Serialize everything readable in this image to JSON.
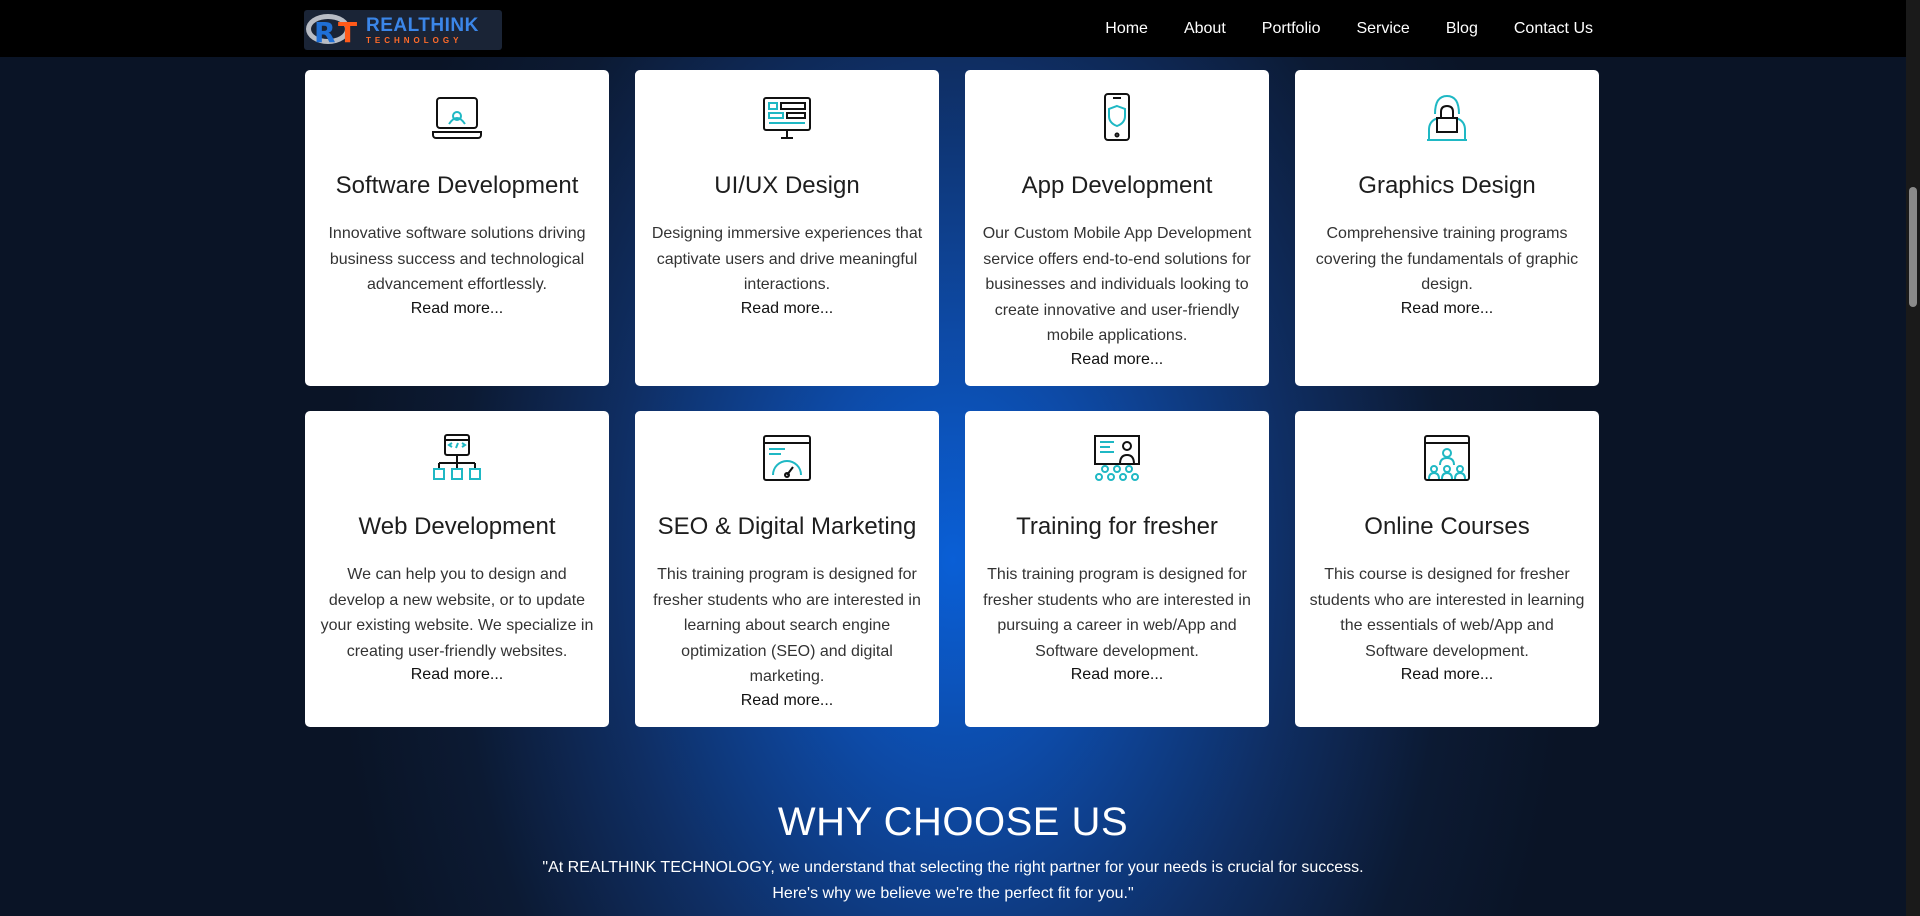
{
  "brand": {
    "name": "REALTHINK",
    "sub": "TECHNOLOGY",
    "mark_r": "R",
    "mark_t": "T"
  },
  "nav": [
    "Home",
    "About",
    "Portfolio",
    "Service",
    "Blog",
    "Contact Us"
  ],
  "cards": [
    {
      "icon": "laptop-icon",
      "title": "Software Development",
      "desc": "Innovative software solutions driving business success and technological advancement effortlessly.",
      "more": "Read more..."
    },
    {
      "icon": "monitor-layout-icon",
      "title": "UI/UX Design",
      "desc": "Designing immersive experiences that captivate users and drive meaningful interactions.",
      "more": "Read more..."
    },
    {
      "icon": "smartphone-icon",
      "title": "App Development",
      "desc": "Our Custom Mobile App Development service offers end-to-end solutions for businesses and individuals looking to create innovative and user-friendly mobile applications.",
      "more": "Read more..."
    },
    {
      "icon": "hacker-icon",
      "title": "Graphics Design",
      "desc": "Comprehensive training programs covering the fundamentals of graphic design.",
      "more": "Read more..."
    },
    {
      "icon": "code-network-icon",
      "title": "Web Development",
      "desc": "We can help you to design and develop a new website, or to update your existing website. We specialize in creating user-friendly websites.",
      "more": "Read more..."
    },
    {
      "icon": "speed-gauge-icon",
      "title": "SEO & Digital Marketing",
      "desc": "This training program is designed for fresher students who are interested in learning about search engine optimization (SEO) and digital marketing.",
      "more": "Read more..."
    },
    {
      "icon": "classroom-icon",
      "title": "Training for fresher",
      "desc": "This training program is designed for fresher students who are interested in pursuing a career in web/App and Software development.",
      "more": "Read more..."
    },
    {
      "icon": "online-course-icon",
      "title": "Online Courses",
      "desc": "This course is designed for fresher students who are interested in learning the essentials of web/App and Software development.",
      "more": "Read more..."
    }
  ],
  "why": {
    "title": "WHY CHOOSE US",
    "line1": "\"At REALTHINK TECHNOLOGY, we understand that selecting the right partner for your needs is crucial for success.",
    "line2": "Here's why we believe we're the perfect fit for you.\""
  },
  "colors": {
    "accent": "#1fb8c4",
    "dark": "#111111",
    "nav_bg": "#000000"
  }
}
